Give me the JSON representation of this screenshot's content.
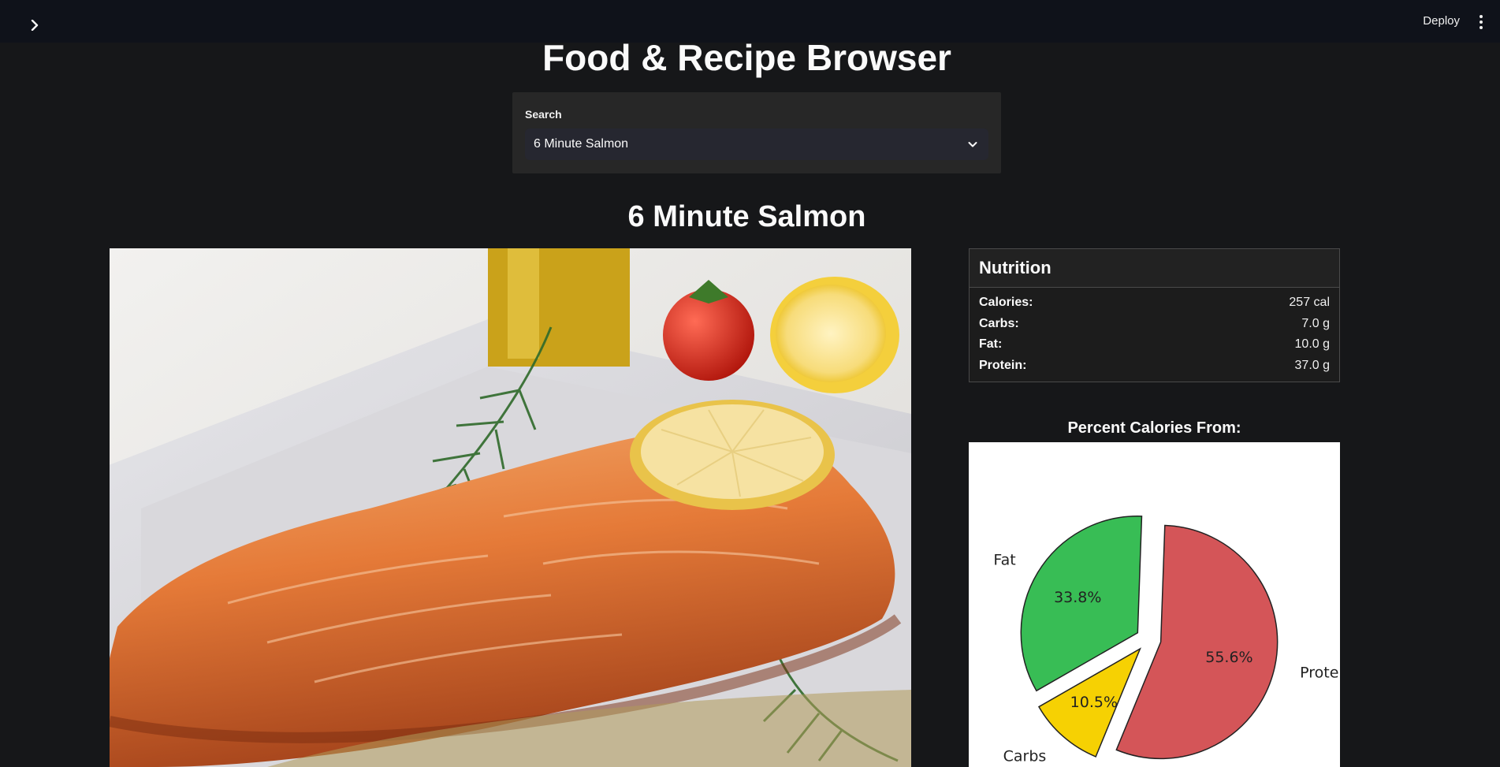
{
  "header": {
    "deploy_label": "Deploy",
    "sidebar_toggle_icon": "chevron-right-icon",
    "menu_icon": "vertical-dots-icon"
  },
  "app": {
    "title": "Food & Recipe Browser"
  },
  "search": {
    "label": "Search",
    "selected": "6 Minute Salmon"
  },
  "recipe": {
    "title": "6 Minute Salmon",
    "image_description": "Grilled salmon fillet topped with a lemon slice on a white plate with dill, tomato, lemon half and olive oil"
  },
  "nutrition": {
    "heading": "Nutrition",
    "rows": [
      {
        "label": "Calories:",
        "value": "257 cal"
      },
      {
        "label": "Carbs:",
        "value": "7.0 g"
      },
      {
        "label": "Fat:",
        "value": "10.0 g"
      },
      {
        "label": "Protein:",
        "value": "37.0 g"
      }
    ]
  },
  "chart_heading": "Percent Calories From:",
  "chart_data": {
    "type": "pie",
    "title": "",
    "slices": [
      {
        "label": "Protein",
        "value": 55.6,
        "pct_label": "55.6%",
        "color": "#d45558"
      },
      {
        "label": "Carbs",
        "value": 10.5,
        "pct_label": "10.5%",
        "color": "#f6d103"
      },
      {
        "label": "Fat",
        "value": 33.8,
        "pct_label": "33.8%",
        "color": "#38bd55"
      }
    ],
    "exploded": true
  },
  "colors": {
    "background": "#161719",
    "topbar": "#0f121a",
    "panel": "#272727"
  }
}
